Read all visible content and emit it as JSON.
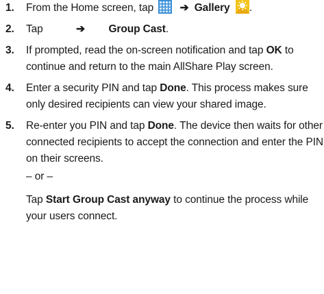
{
  "steps": [
    {
      "number": "1.",
      "parts": {
        "a": "From the Home screen, tap",
        "arrow": "➔",
        "b": "Gallery"
      },
      "icons": [
        "apps-grid-icon",
        "gallery-icon"
      ]
    },
    {
      "number": "2.",
      "parts": {
        "a": "Tap",
        "arrow": "➔",
        "b": "Group Cast",
        "c": "."
      }
    },
    {
      "number": "3.",
      "parts": {
        "a": "If prompted, read the on-screen notification and tap",
        "b": "OK",
        "c": "to continue and return to the main AllShare Play screen."
      }
    },
    {
      "number": "4.",
      "parts": {
        "a": "Enter a security PIN and tap",
        "b": "Done",
        "c": ". This process makes sure only desired recipients can view your shared image."
      }
    },
    {
      "number": "5.",
      "parts": {
        "a": "Re-enter you PIN and tap",
        "b": "Done",
        "c": ". The device then waits for other connected recipients to accept the connection and enter the PIN on their screens.",
        "or": "– or –",
        "d": "Tap",
        "e": "Start Group Cast anyway",
        "f": "to continue the process while your users connect."
      }
    }
  ],
  "colors": {
    "text": "#1a1a1a",
    "grid_icon": "#3a8fd8",
    "gallery_icon": "#f2c418"
  }
}
